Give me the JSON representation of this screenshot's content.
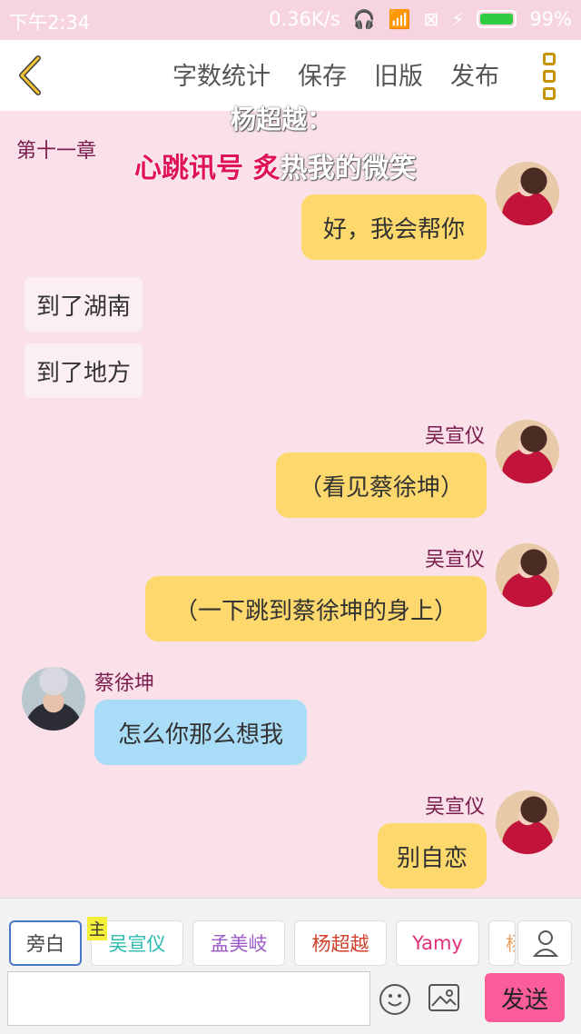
{
  "status_bar": {
    "time": "下午2:34",
    "speed": "0.36K/s",
    "battery": "99%"
  },
  "toolbar": {
    "items": [
      "字数统计",
      "保存",
      "旧版",
      "发布"
    ]
  },
  "chapter_title": "第十一章",
  "overlay": {
    "speaker": "杨超越：",
    "pink_text": "心跳讯号 炙",
    "white_text": "热我的微笑"
  },
  "messages": [
    {
      "text": "好，我会帮你"
    },
    {
      "text": "到了湖南"
    },
    {
      "text": "到了地方"
    },
    {
      "name": "吴宣仪",
      "text": "（看见蔡徐坤）"
    },
    {
      "name": "吴宣仪",
      "text": "（一下跳到蔡徐坤的身上）"
    },
    {
      "name": "蔡徐坤",
      "text": "怎么你那么想我"
    },
    {
      "name": "吴宣仪",
      "text": "别自恋"
    }
  ],
  "characters": {
    "narrator": "旁白",
    "host_tag": "主",
    "list": [
      {
        "name": "吴宣仪",
        "color": "#2bbbb0"
      },
      {
        "name": "孟美岐",
        "color": "#9b59c8"
      },
      {
        "name": "杨超越",
        "color": "#d0402a"
      },
      {
        "name": "Yamy",
        "color": "#e0307a"
      },
      {
        "name": "杨",
        "color": "#e8a060"
      }
    ]
  },
  "input": {
    "placeholder": ""
  },
  "send_label": "发送"
}
